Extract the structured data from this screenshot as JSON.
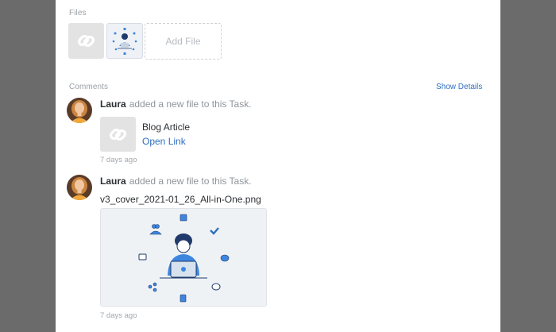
{
  "files": {
    "label": "Files",
    "add_file_label": "Add File"
  },
  "comments": {
    "label": "Comments",
    "show_details_label": "Show Details",
    "items": [
      {
        "author": "Laura",
        "action": "added a new file to this Task.",
        "attachment": {
          "title": "Blog Article",
          "link_label": "Open Link"
        },
        "time": "7 days ago"
      },
      {
        "author": "Laura",
        "action": "added a new file to this Task.",
        "file_name": "v3_cover_2021-01_26_All-in-One.png",
        "time": "7 days ago"
      }
    ]
  },
  "colors": {
    "link": "#2f6fbf",
    "overlay": "#6b6b6b",
    "panel": "#ffffff"
  },
  "icons": [
    "link-icon",
    "illustration-thumbnail",
    "avatar-laura"
  ]
}
